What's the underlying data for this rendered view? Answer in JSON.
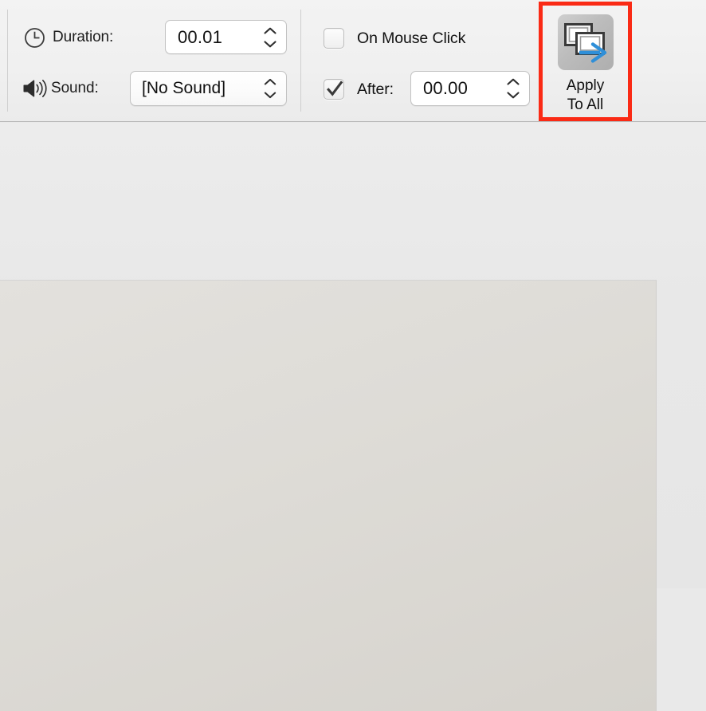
{
  "toolbar": {
    "duration": {
      "icon": "clock-icon",
      "label": "Duration:",
      "value": "00.01"
    },
    "sound": {
      "icon": "speaker-icon",
      "label": "Sound:",
      "value": "[No Sound]"
    },
    "advance": {
      "on_mouse_click": {
        "label": "On Mouse Click",
        "checked": false
      },
      "after": {
        "label": "After:",
        "checked": true,
        "value": "00.00"
      }
    },
    "apply_to_all": {
      "icon": "apply-to-all-slides-icon",
      "label": "Apply\nTo All",
      "highlight_color": "#fa2a15"
    }
  },
  "workspace": {
    "slide_background": "#ded9d3"
  }
}
